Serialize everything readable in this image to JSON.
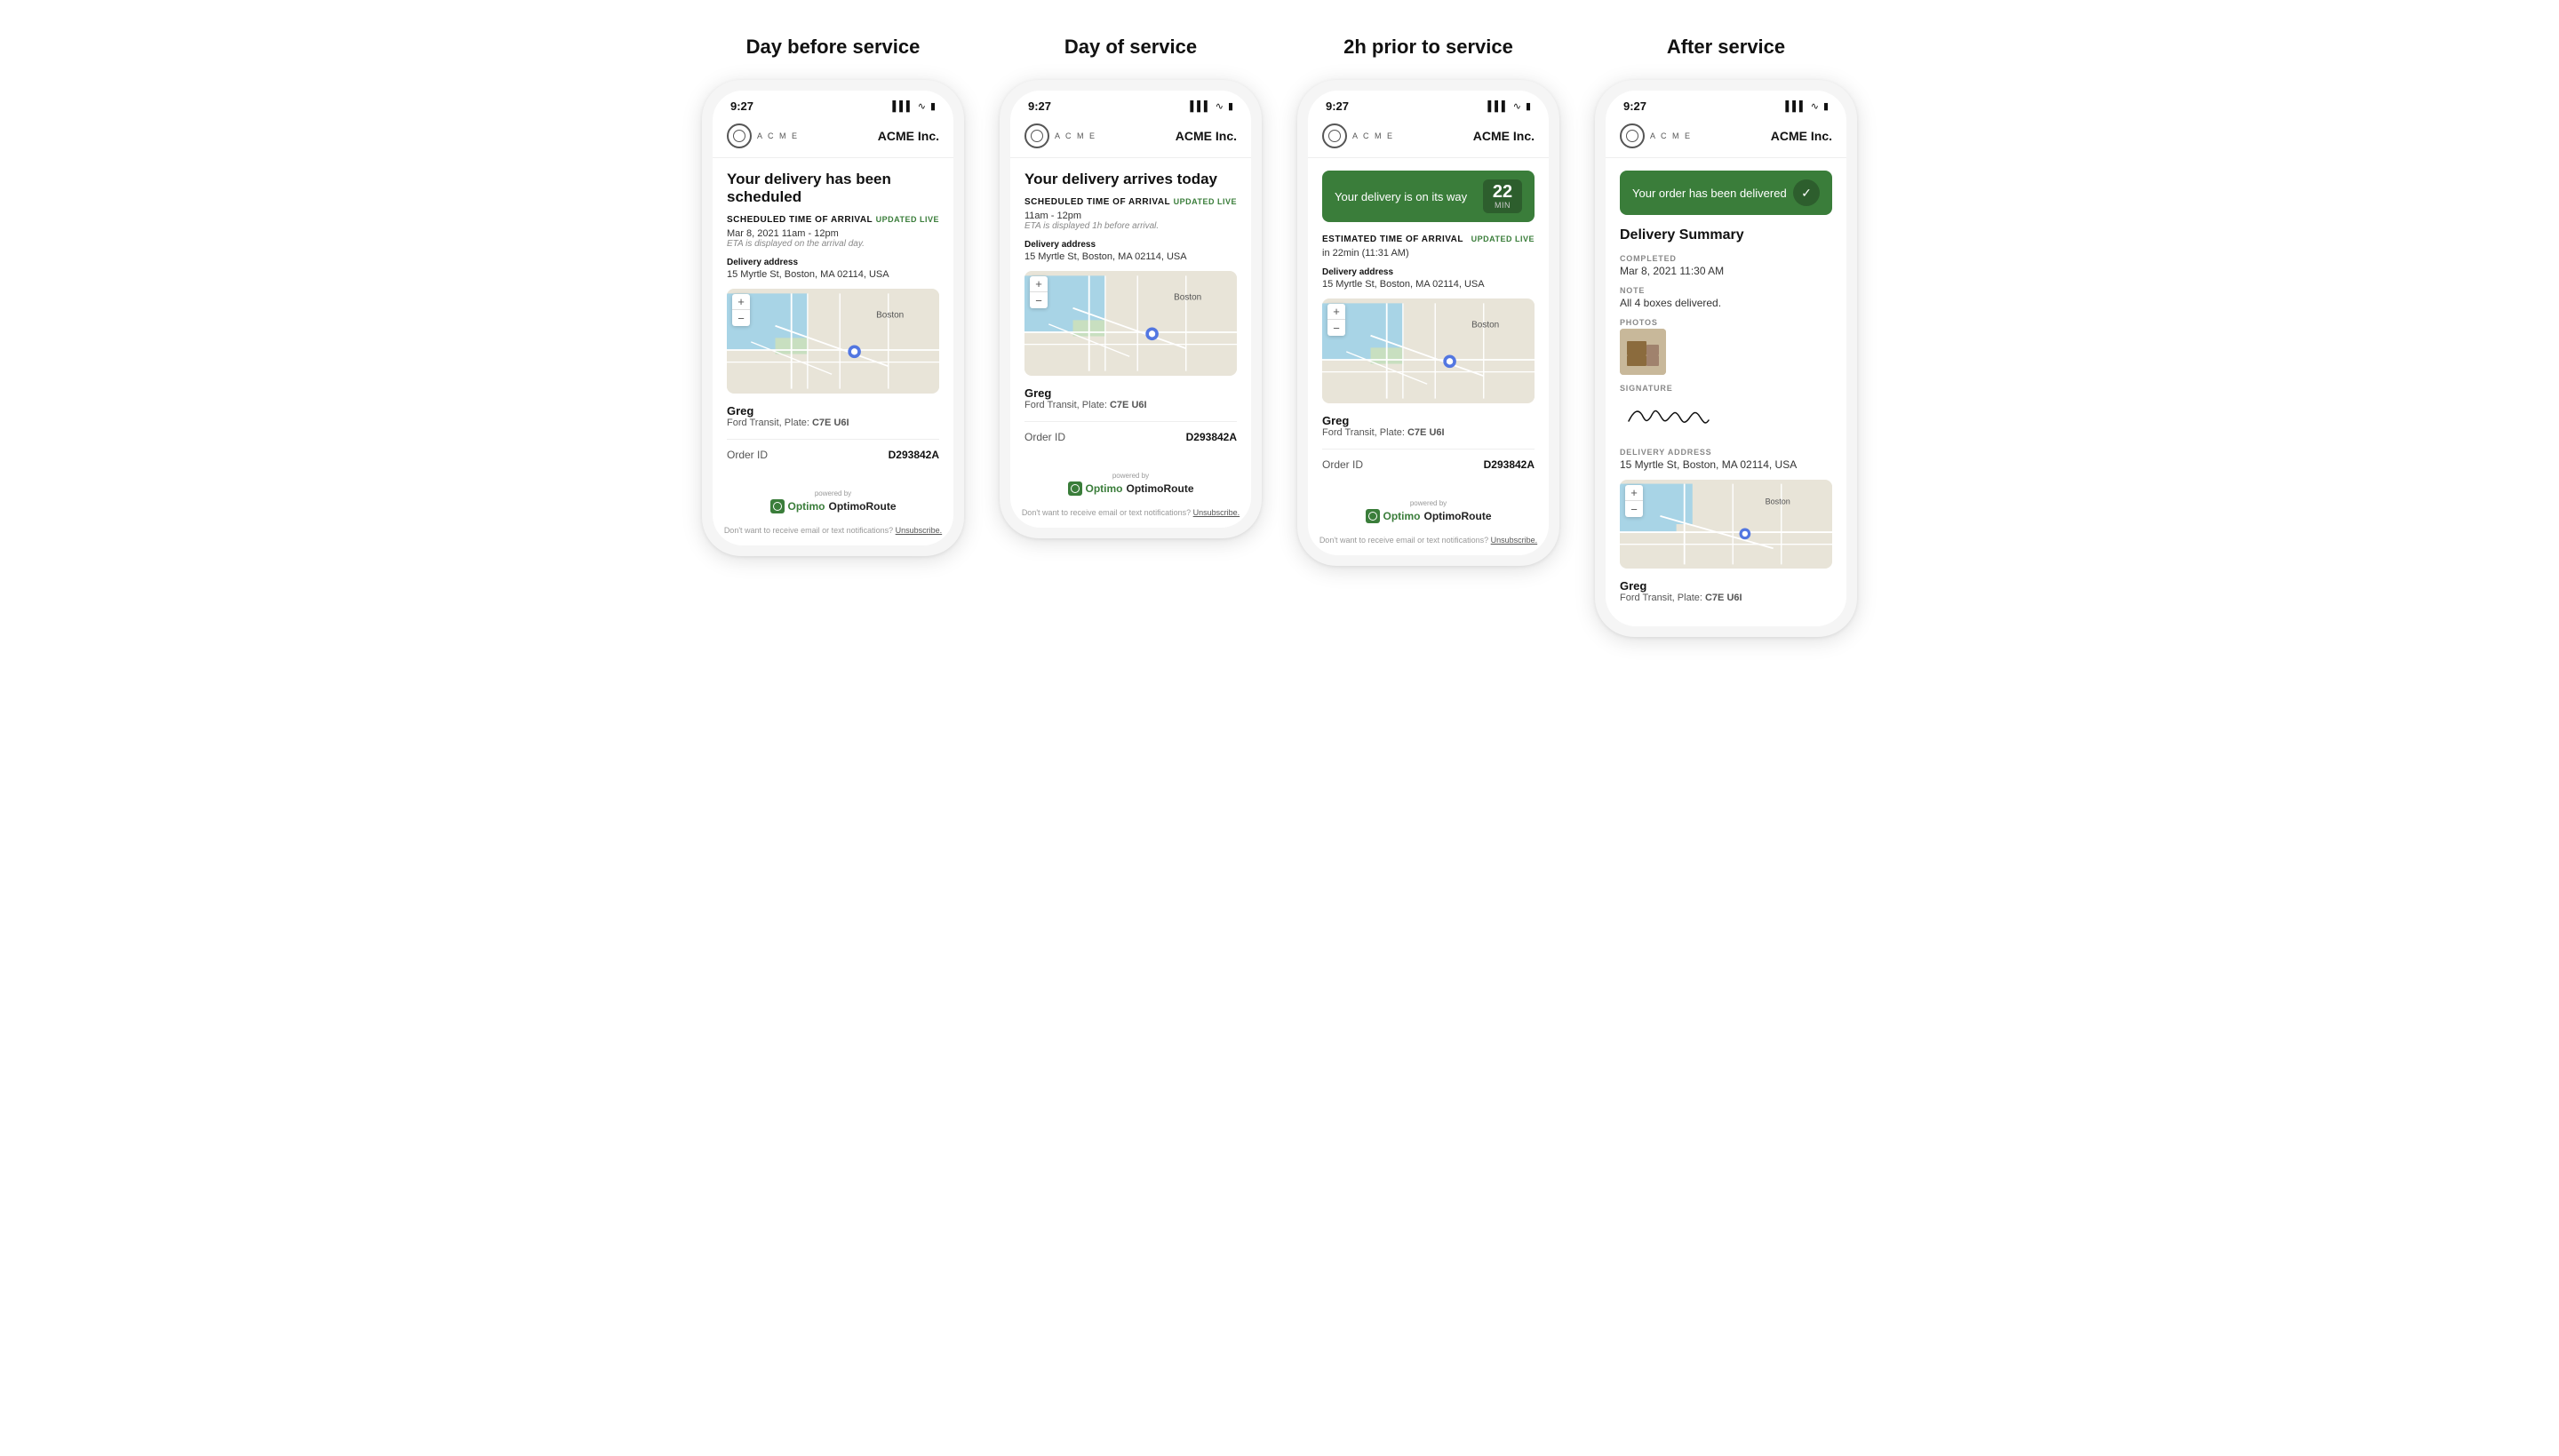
{
  "sections": [
    {
      "title": "Day before service",
      "phone": {
        "status_time": "9:27",
        "company": "ACME Inc.",
        "banner": null,
        "main_title": "Your delivery has been scheduled",
        "arrival_label": "Scheduled time of arrival",
        "arrival_value": "Mar 8, 2021  11am - 12pm",
        "arrival_note": "ETA is displayed on the arrival day.",
        "updated_live": "UPDATED LIVE",
        "address_label": "Delivery address",
        "address_value": "15 Myrtle St, Boston, MA 02114, USA",
        "driver_name": "Greg",
        "driver_detail": "Ford Transit, Plate: C7E U6I",
        "order_id_label": "Order ID",
        "order_id_value": "D293842A",
        "show_unsubscribe": true
      }
    },
    {
      "title": "Day of service",
      "phone": {
        "status_time": "9:27",
        "company": "ACME Inc.",
        "banner": null,
        "main_title": "Your delivery arrives today",
        "arrival_label": "Scheduled time of arrival",
        "arrival_value": "11am - 12pm",
        "arrival_note": "ETA is displayed 1h before arrival.",
        "updated_live": "UPDATED LIVE",
        "address_label": "Delivery address",
        "address_value": "15 Myrtle St, Boston, MA 02114, USA",
        "driver_name": "Greg",
        "driver_detail": "Ford Transit, Plate: C7E U6I",
        "order_id_label": "Order ID",
        "order_id_value": "D293842A",
        "show_unsubscribe": true
      }
    },
    {
      "title": "2h prior to service",
      "phone": {
        "status_time": "9:27",
        "company": "ACME Inc.",
        "banner": {
          "type": "countdown",
          "text": "Your delivery is on its way",
          "number": "22",
          "unit": "MIN"
        },
        "main_title": null,
        "arrival_label": "Estimated time of arrival",
        "arrival_value": "in 22min (11:31 AM)",
        "arrival_note": null,
        "updated_live": "UPDATED LIVE",
        "address_label": "Delivery address",
        "address_value": "15 Myrtle St, Boston, MA 02114, USA",
        "driver_name": "Greg",
        "driver_detail": "Ford Transit, Plate: C7E U6I",
        "order_id_label": "Order ID",
        "order_id_value": "D293842A",
        "show_unsubscribe": true
      }
    },
    {
      "title": "After service",
      "phone": {
        "status_time": "9:27",
        "company": "ACME Inc.",
        "banner": {
          "type": "delivered",
          "text": "Your order has been delivered"
        },
        "delivery_summary_title": "Delivery Summary",
        "completed_label": "COMPLETED",
        "completed_value": "Mar 8, 2021 11:30 AM",
        "note_label": "NOTE",
        "note_value": "All 4 boxes delivered.",
        "photos_label": "PHOTOS",
        "signature_label": "SIGNATURE",
        "address_label": "DELIVERY ADDRESS",
        "address_value": "15 Myrtle St, Boston, MA 02114, USA",
        "driver_name": "Greg",
        "driver_detail": "Ford Transit, Plate: C7E U6I",
        "show_unsubscribe": false
      }
    }
  ],
  "powered_by": "powered by",
  "optimo_text": "OptimoRoute",
  "unsubscribe_text": "Don't want to receive email or text notifications?",
  "unsubscribe_link": "Unsubscribe."
}
